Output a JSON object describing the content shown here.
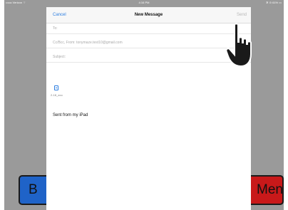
{
  "status_bar": {
    "carrier": "•••oo Verizon ⌔",
    "time": "4:16 PM",
    "battery": "✲ ⊙ 61% ▭"
  },
  "background": {
    "left_button_label": "B",
    "right_button_label": "Menu"
  },
  "compose": {
    "cancel_label": "Cancel",
    "title": "New Message",
    "send_label": "Send",
    "to_label": "To:",
    "cc_bcc_label": "Cc/Bcc, From: tonymaze.test10@gmail.com",
    "subject_label": "Subject:",
    "attachment_name": "2-18_zoo",
    "signature": "Sent from my iPad"
  },
  "colors": {
    "accent": "#2b7de0",
    "left_button": "#1f63c8",
    "right_button": "#c8191a"
  },
  "icons": {
    "attachment": "document-icon",
    "cursor": "hand-pointer-icon"
  }
}
